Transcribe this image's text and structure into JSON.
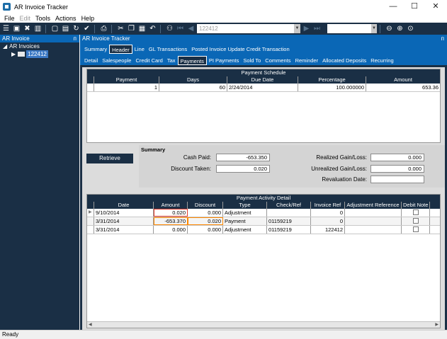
{
  "window": {
    "title": "AR Invoice Tracker",
    "minimize": "—",
    "maximize": "☐",
    "close": "✕"
  },
  "menu": {
    "file": "File",
    "edit": "Edit",
    "tools": "Tools",
    "actions": "Actions",
    "help": "Help"
  },
  "toolbar": {
    "record": "122412"
  },
  "left_panel": {
    "title": "AR Invoice",
    "pin": "ᴨ",
    "root": "AR Invoices",
    "node": "122412"
  },
  "main_panel": {
    "title": "AR Invoice Tracker",
    "pin": "ᴨ"
  },
  "tabs_top": [
    "Summary",
    "Header",
    "Line",
    "GL Transactions",
    "Posted Invoice Update Credit Transaction"
  ],
  "tabs_sub": [
    "Detail",
    "Salespeople",
    "Credit Card",
    "Tax",
    "Payments",
    "PI Payments",
    "Sold To",
    "Comments",
    "Reminder",
    "Allocated Deposits",
    "Recurring"
  ],
  "payment_schedule": {
    "caption": "Payment Schedule",
    "columns": [
      "Payment",
      "Days",
      "Due Date",
      "Percentage",
      "Amount"
    ],
    "rows": [
      {
        "payment": "1",
        "days": "60",
        "due_date": "2/24/2014",
        "percentage": "100.000000",
        "amount": "653.36"
      }
    ]
  },
  "retrieve_label": "Retrieve",
  "summary": {
    "title": "Summary",
    "cash_paid_label": "Cash Paid:",
    "cash_paid": "-653.350",
    "discount_taken_label": "Discount Taken:",
    "discount_taken": "0.020",
    "realized_label": "Realized Gain/Loss:",
    "realized": "0.000",
    "unrealized_label": "Unrealized Gain/Loss:",
    "unrealized": "0.000",
    "revaluation_label": "Revaluation Date:",
    "revaluation": ""
  },
  "activity": {
    "caption": "Payment Activity Detail",
    "columns": [
      "Date",
      "Amount",
      "Discount",
      "Type",
      "Check/Ref",
      "Invoice Ref",
      "Adjustment Reference",
      "Debit Note"
    ],
    "rows": [
      {
        "date": "9/10/2014",
        "amount": "0.020",
        "discount": "0.000",
        "type": "Adjustment",
        "check": "",
        "invoice": "0",
        "adj": ""
      },
      {
        "date": "3/31/2014",
        "amount": "-653.370",
        "discount": "0.020",
        "type": "Payment",
        "check": "01159219",
        "invoice": "0",
        "adj": ""
      },
      {
        "date": "3/31/2014",
        "amount": "0.000",
        "discount": "0.000",
        "type": "Adjustment",
        "check": "01159219",
        "invoice": "122412",
        "adj": ""
      }
    ]
  },
  "status": "Ready",
  "colors": {
    "navy": "#1a2f45",
    "blue": "#0a67b6",
    "highlight_red": "#e03b2b",
    "highlight_orange": "#ff8800"
  }
}
